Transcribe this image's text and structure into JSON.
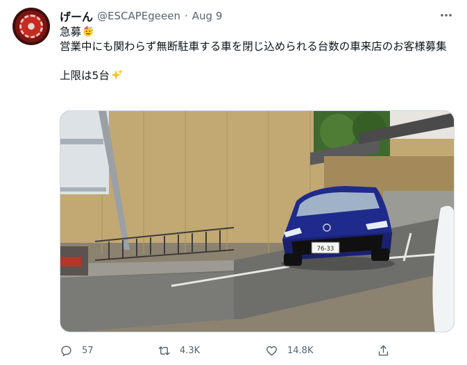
{
  "tweet": {
    "display_name": "げーん",
    "handle": "@ESCAPEgeeen",
    "separator": "·",
    "date": "Aug 9",
    "lines": [
      "急募",
      "営業中にも関わらず無断駐車する車を閉じ込められる台数の車来店のお客様募集",
      "上限は5台"
    ],
    "emojis": [
      "party-face-emoji",
      "sparkles-emoji"
    ],
    "plate_text": "76-33"
  },
  "actions": {
    "reply_count": "57",
    "retweet_count": "4.3K",
    "like_count": "14.8K"
  },
  "colors": {
    "text": "#0f1419",
    "muted": "#536471",
    "border": "#cfd9de",
    "car_blue": "#1e2a8c"
  },
  "icons": [
    "more-icon",
    "reply-icon",
    "retweet-icon",
    "like-icon",
    "share-icon"
  ]
}
